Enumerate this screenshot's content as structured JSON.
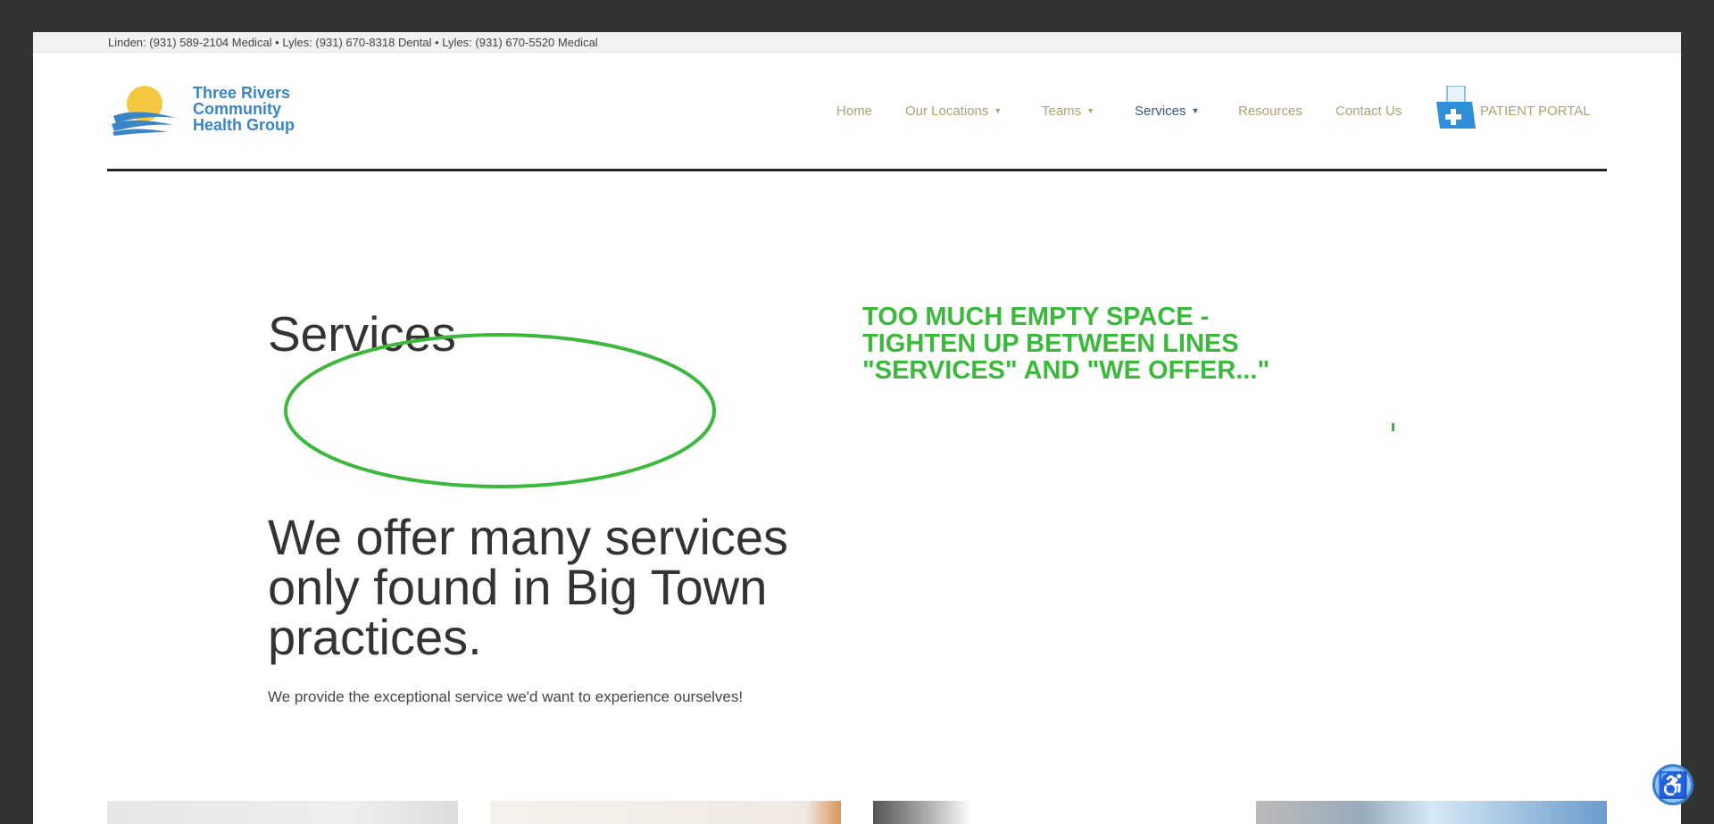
{
  "topbar": {
    "text": "Linden:  (931) 589-2104 Medical  •  Lyles: (931) 670-8318 Dental  •  Lyles: (931) 670-5520 Medical"
  },
  "logo": {
    "line1": "Three Rivers",
    "line2": "Community",
    "line3": "Health Group"
  },
  "nav": {
    "home": "Home",
    "locations": "Our Locations",
    "teams": "Teams",
    "services": "Services",
    "resources": "Resources",
    "contact": "Contact Us",
    "portal": "PATIENT PORTAL"
  },
  "main": {
    "title": "Services",
    "heading": "We offer many services only found in Big Town practices.",
    "subtext": "We provide the exceptional service we'd want to experience ourselves!"
  },
  "annotation": {
    "note": "TOO MUCH EMPTY SPACE - TIGHTEN UP BETWEEN LINES \"SERVICES\" AND \"WE OFFER...\""
  },
  "colors": {
    "accent": "#b0a070",
    "active": "#355a85",
    "annotation": "#3cb93c"
  }
}
